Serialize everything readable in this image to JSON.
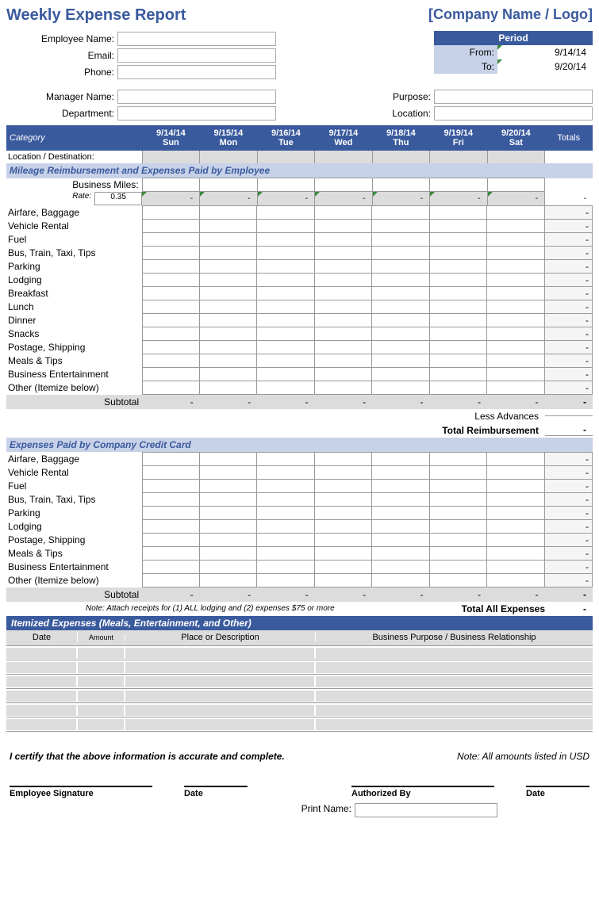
{
  "header": {
    "title": "Weekly Expense Report",
    "company": "[Company Name / Logo]"
  },
  "employee": {
    "name_label": "Employee Name:",
    "email_label": "Email:",
    "phone_label": "Phone:",
    "manager_label": "Manager Name:",
    "department_label": "Department:"
  },
  "period": {
    "header": "Period",
    "from_label": "From:",
    "to_label": "To:",
    "from_value": "9/14/14",
    "to_value": "9/20/14"
  },
  "purpose": {
    "purpose_label": "Purpose:",
    "location_label": "Location:"
  },
  "columns": {
    "category": "Category",
    "totals": "Totals",
    "days": [
      {
        "date": "9/14/14",
        "dow": "Sun"
      },
      {
        "date": "9/15/14",
        "dow": "Mon"
      },
      {
        "date": "9/16/14",
        "dow": "Tue"
      },
      {
        "date": "9/17/14",
        "dow": "Wed"
      },
      {
        "date": "9/18/14",
        "dow": "Thu"
      },
      {
        "date": "9/19/14",
        "dow": "Fri"
      },
      {
        "date": "9/20/14",
        "dow": "Sat"
      }
    ]
  },
  "location_row": "Location / Destination:",
  "section1": {
    "title": "Mileage Reimbursement and Expenses Paid by Employee",
    "business_miles": "Business Miles:",
    "rate_label": "Rate:",
    "rate_value": "0.35",
    "dash": "-",
    "rows": [
      "Airfare, Baggage",
      "Vehicle Rental",
      "Fuel",
      "Bus, Train, Taxi, Tips",
      "Parking",
      "Lodging",
      "Breakfast",
      "Lunch",
      "Dinner",
      "Snacks",
      "Postage, Shipping",
      "Meals & Tips",
      "Business Entertainment",
      "Other (Itemize below)"
    ],
    "subtotal": "Subtotal",
    "less_advances": "Less Advances",
    "total_reimbursement": "Total Reimbursement"
  },
  "section2": {
    "title": "Expenses Paid by Company Credit Card",
    "rows": [
      "Airfare, Baggage",
      "Vehicle Rental",
      "Fuel",
      "Bus, Train, Taxi, Tips",
      "Parking",
      "Lodging",
      "Postage, Shipping",
      "Meals & Tips",
      "Business Entertainment",
      "Other (Itemize below)"
    ],
    "subtotal": "Subtotal",
    "note": "Note:  Attach receipts for (1) ALL lodging and (2) expenses $75 or more",
    "total_all": "Total All Expenses"
  },
  "itemized": {
    "title": "Itemized Expenses (Meals, Entertainment, and Other)",
    "cols": {
      "date": "Date",
      "amount": "Amount",
      "place": "Place or Description",
      "purpose": "Business Purpose / Business Relationship"
    }
  },
  "cert": {
    "text": "I certify that the above information is accurate and complete.",
    "note": "Note: All amounts listed in USD"
  },
  "sig": {
    "employee": "Employee Signature",
    "date": "Date",
    "authorized": "Authorized By",
    "print_name": "Print Name:"
  },
  "dash": "-"
}
